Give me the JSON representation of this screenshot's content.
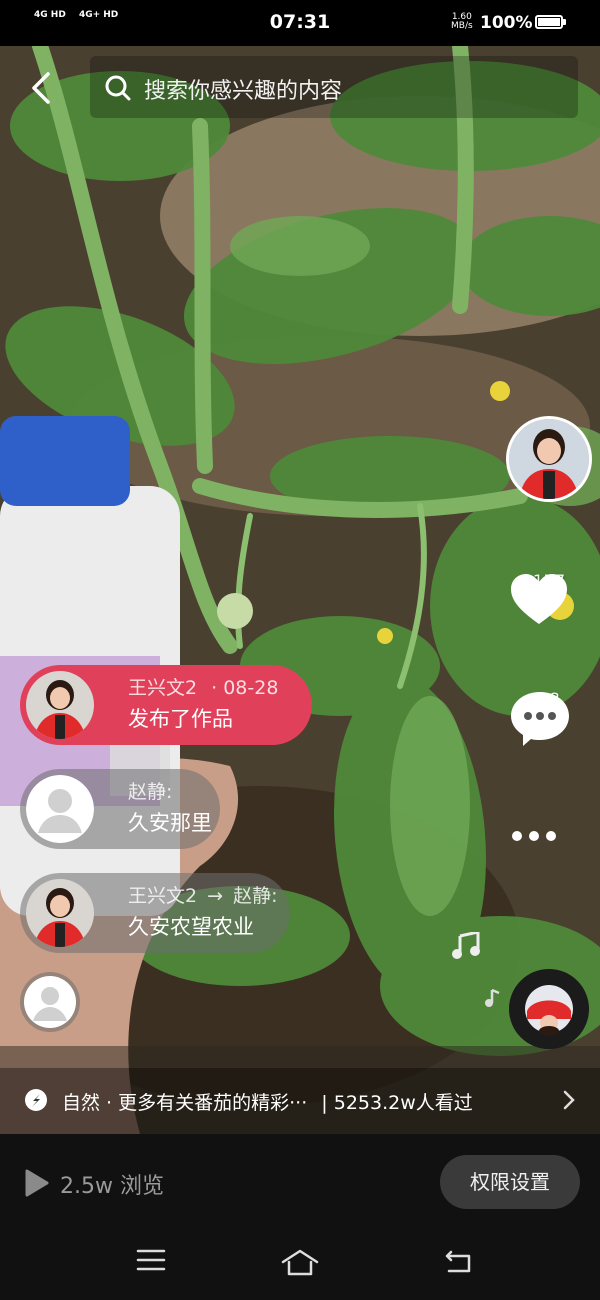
{
  "status_bar": {
    "network_1": "4G HD",
    "network_2": "4G+ HD",
    "time": "07:31",
    "speed_value": "1.60",
    "speed_unit": "MB/s",
    "battery": "100%"
  },
  "search": {
    "placeholder": "搜索你感兴趣的内容"
  },
  "right_rail": {
    "like_count": "177",
    "comment_count": "18"
  },
  "comments": [
    {
      "author": "王兴文2",
      "meta": "· 08-28",
      "text": "发布了作品"
    },
    {
      "author": "赵静:",
      "text": "久安那里"
    },
    {
      "author": "王兴文2",
      "reply_to": "赵静:",
      "text": "久安农望农业"
    }
  ],
  "topic": {
    "text": "自然 · 更多有关番茄的精彩···",
    "views_text": "| 5253.2w人看过"
  },
  "bottom": {
    "views": "2.5w 浏览",
    "permission_button": "权限设置"
  },
  "colors": {
    "highlight_bubble": "#e0405a",
    "grey_bubble": "rgba(110,110,110,0.55)",
    "bottom_bg": "#111111"
  }
}
